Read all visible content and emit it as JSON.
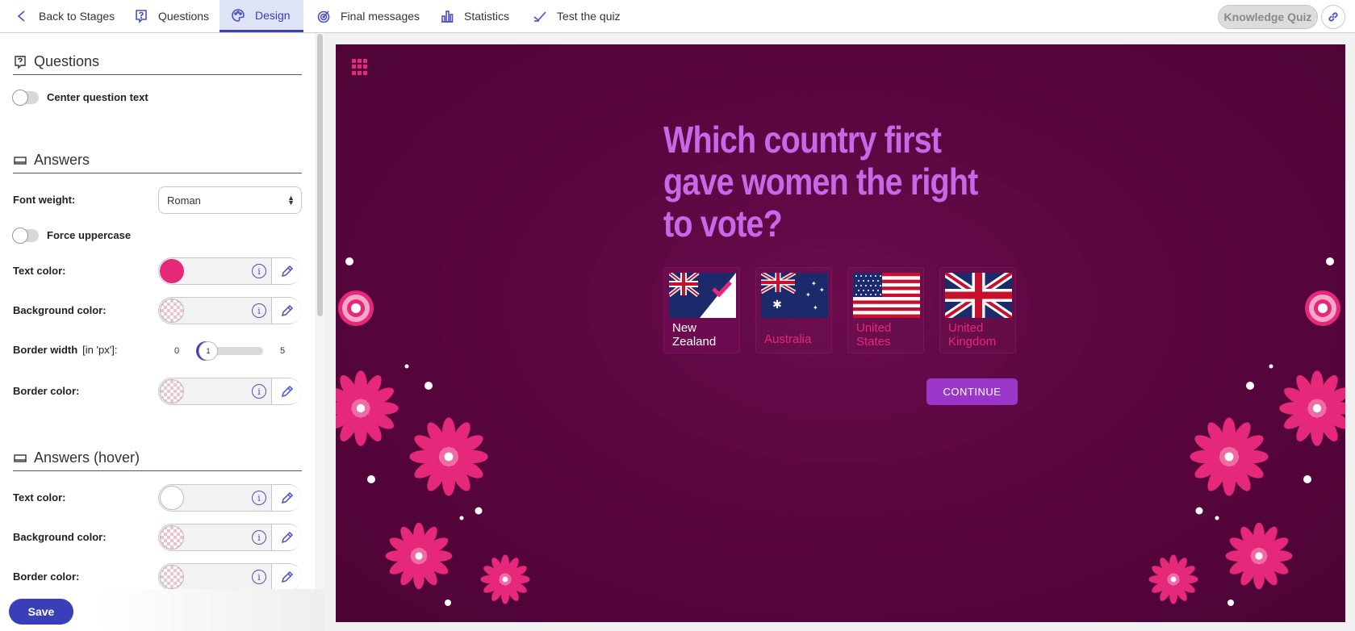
{
  "nav": {
    "back": "Back to Stages",
    "questions": "Questions",
    "design": "Design",
    "final_messages": "Final messages",
    "statistics": "Statistics",
    "test": "Test the quiz",
    "quiz_name": "Knowledge Quiz"
  },
  "panel": {
    "questions_section": {
      "title": "Questions",
      "center_toggle_label": "Center question text",
      "center_toggle_on": false
    },
    "answers_section": {
      "title": "Answers",
      "font_weight_label": "Font weight:",
      "font_weight_value": "Roman",
      "uppercase_label": "Force uppercase",
      "uppercase_on": false,
      "text_color_label": "Text color:",
      "text_color": "#e5287a",
      "bg_color_label": "Background color:",
      "bg_color": "transparent",
      "border_width_label": "Border width",
      "border_width_unit": "[in 'px']:",
      "border_width_min": "0",
      "border_width_max": "5",
      "border_width_value": "1",
      "border_color_label": "Border color:",
      "border_color": "transparent"
    },
    "answers_hover_section": {
      "title": "Answers (hover)",
      "text_color_label": "Text color:",
      "text_color": "#ffffff",
      "bg_color_label": "Background color:",
      "border_color_label": "Border color:"
    },
    "save": "Save"
  },
  "preview": {
    "question": "Which country first gave women the right to vote?",
    "answers": [
      {
        "label": "New Zealand",
        "selected": true,
        "flag": "new-zealand-flag"
      },
      {
        "label": "Australia",
        "selected": false,
        "flag": "australia-flag"
      },
      {
        "label": "United States",
        "selected": false,
        "flag": "united-states-flag"
      },
      {
        "label": "United Kingdom",
        "selected": false,
        "flag": "united-kingdom-flag"
      }
    ],
    "continue": "CONTINUE",
    "colors": {
      "background": "#5a063f",
      "question_text": "#c768e8",
      "accent": "#e5287a",
      "button": "#9a37c9"
    }
  }
}
